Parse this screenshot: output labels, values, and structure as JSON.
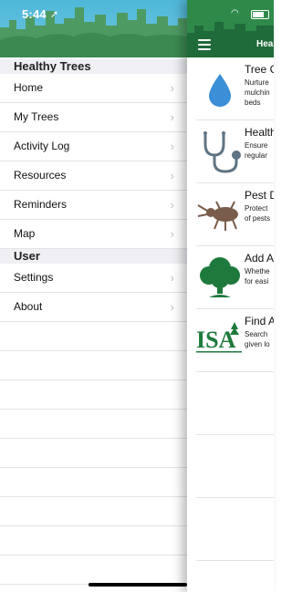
{
  "status_bar": {
    "time": "5:44"
  },
  "drawer": {
    "section_main": "Healthy Trees",
    "items_main": [
      {
        "label": "Home"
      },
      {
        "label": "My Trees"
      },
      {
        "label": "Activity Log"
      },
      {
        "label": "Resources"
      },
      {
        "label": "Reminders"
      },
      {
        "label": "Map"
      }
    ],
    "section_user": "User",
    "items_user": [
      {
        "label": "Settings"
      },
      {
        "label": "About"
      }
    ]
  },
  "main": {
    "title": "Hea",
    "cards": [
      {
        "title": "Tree C",
        "desc": [
          "Nurture",
          "mulchin",
          "beds"
        ],
        "icon": "water-drop-icon"
      },
      {
        "title": "Health",
        "desc": [
          "Ensure",
          "regular"
        ],
        "icon": "stethoscope-icon"
      },
      {
        "title": "Pest D",
        "desc": [
          "Protect",
          "of pests"
        ],
        "icon": "beetle-icon"
      },
      {
        "title": "Add A",
        "desc": [
          "Whethe",
          "for easi"
        ],
        "icon": "tree-icon"
      },
      {
        "title": "Find A",
        "desc": [
          "Search",
          "given lo"
        ],
        "icon": "isa-logo-icon"
      }
    ]
  },
  "logo_text": "ISA",
  "colors": {
    "header_green": "#1f6b3a",
    "icon_blue": "#3a8fd6",
    "icon_green": "#1e7a3c",
    "icon_brown": "#7a5c4a",
    "icon_slate": "#5f7484"
  }
}
